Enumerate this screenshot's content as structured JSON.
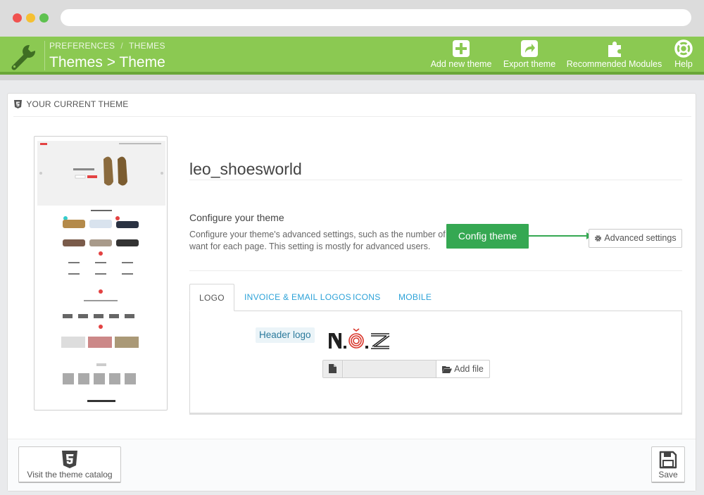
{
  "header": {
    "breadcrumb": [
      "PREFERENCES",
      "THEMES"
    ],
    "breadcrumb_sep": "/",
    "title": "Themes > Theme",
    "toolbar": {
      "add_new_theme": "Add new theme",
      "export_theme": "Export theme",
      "recommended_modules": "Recommended Modules",
      "help": "Help"
    }
  },
  "panel": {
    "heading": "YOUR CURRENT THEME",
    "theme_name": "leo_shoesworld",
    "configure_title": "Configure your theme",
    "configure_desc": "Configure your theme's advanced settings, such as the number of want for each page. This setting is mostly for advanced users.",
    "callout": "Config theme",
    "advanced_settings": "Advanced settings",
    "tabs": [
      "LOGO",
      "INVOICE & EMAIL LOGOS",
      "ICONS",
      "MOBILE"
    ],
    "header_logo_label": "Header logo",
    "add_file": "Add file"
  },
  "footer": {
    "visit_catalog": "Visit the theme catalog",
    "save": "Save"
  },
  "colors": {
    "header_green": "#8bc952",
    "callout_green": "#35a852",
    "tab_link": "#2ca2d8"
  }
}
